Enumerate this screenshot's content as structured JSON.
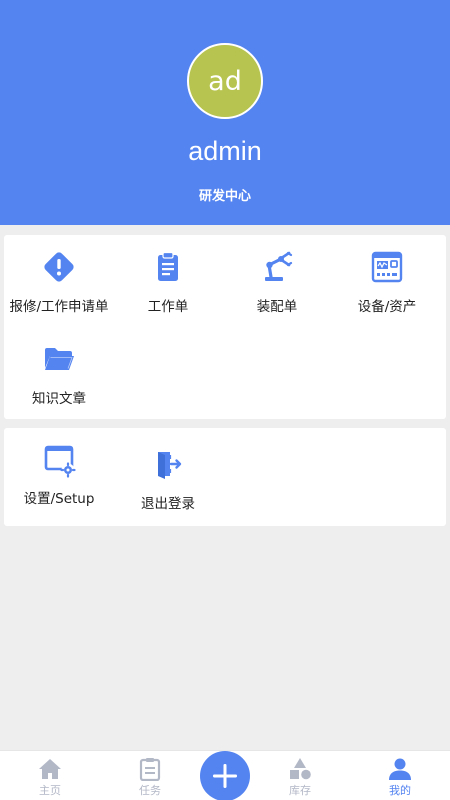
{
  "profile": {
    "avatar_text": "ad",
    "username": "admin",
    "department": "研发中心"
  },
  "menu": [
    {
      "label": "报修/工作申请单",
      "icon": "warning-diamond-icon"
    },
    {
      "label": "工作单",
      "icon": "clipboard-icon"
    },
    {
      "label": "装配单",
      "icon": "robot-arm-icon"
    },
    {
      "label": "设备/资产",
      "icon": "device-panel-icon"
    },
    {
      "label": "知识文章",
      "icon": "folder-open-icon"
    }
  ],
  "settings_menu": [
    {
      "label": "设置/Setup",
      "icon": "window-gear-icon"
    },
    {
      "label": "退出登录",
      "icon": "logout-door-icon"
    }
  ],
  "tabbar": {
    "items": [
      {
        "label": "主页",
        "icon": "home-icon"
      },
      {
        "label": "任务",
        "icon": "task-clipboard-icon"
      },
      {
        "label": "库存",
        "icon": "shapes-icon"
      },
      {
        "label": "我的",
        "icon": "user-icon"
      }
    ],
    "center_icon": "plus-icon",
    "active": "我的"
  },
  "colors": {
    "primary": "#5484f0",
    "avatar_bg": "#b7c44f",
    "page_bg": "#eeeeee",
    "tab_inactive": "#b3b8c7"
  }
}
